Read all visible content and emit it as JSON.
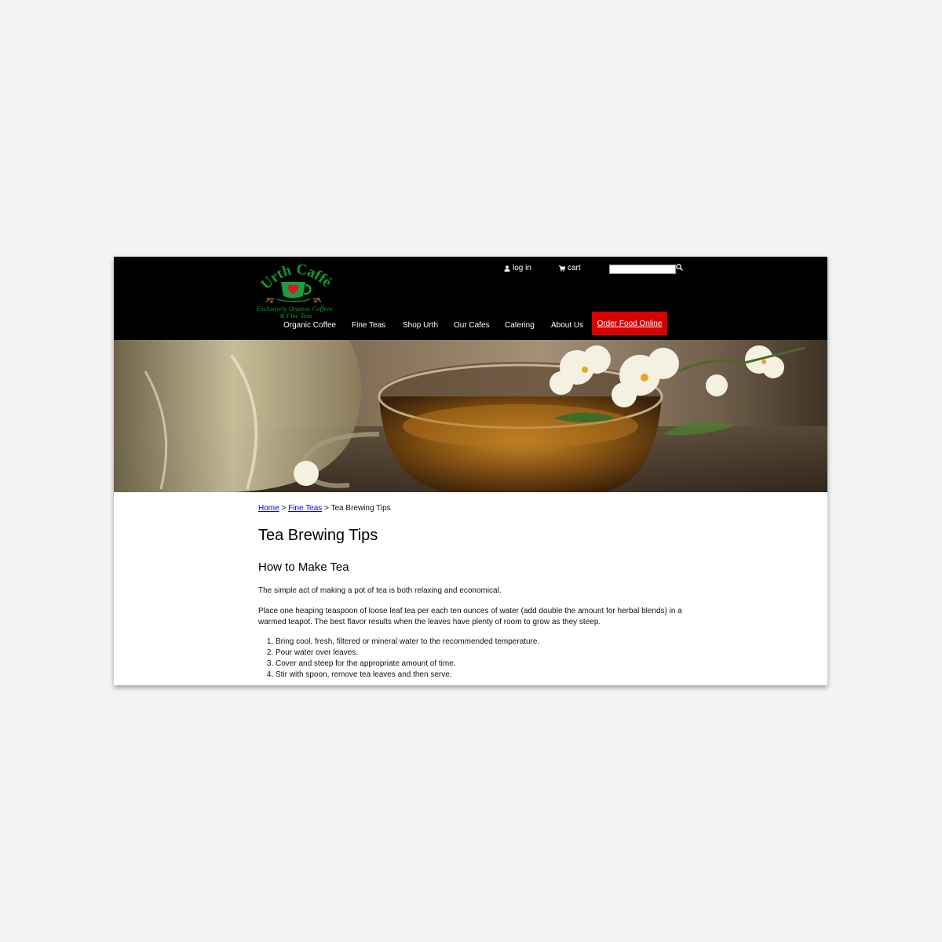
{
  "header": {
    "logo": {
      "brand": "Urth Caffé",
      "tagline_line1": "Exclusively Organic Coffees",
      "tagline_line2": "& Fine Teas",
      "colors": {
        "text": "#0f9a2b",
        "cup": "#1f9b45",
        "heart": "#d61a2a"
      }
    },
    "utility": {
      "login_label": "log in",
      "login_icon": "user-icon",
      "cart_label": "cart",
      "cart_icon": "cart-icon",
      "search_placeholder": "",
      "search_icon": "search-icon"
    },
    "nav": [
      "Organic Coffee",
      "Fine Teas",
      "Shop Urth",
      "Our Cafes",
      "Catering",
      "About Us"
    ],
    "order_button": {
      "label": "Order Food Online",
      "color": "#d90000"
    }
  },
  "breadcrumb": {
    "home": "Home",
    "sep1": " > ",
    "section": "Fine Teas",
    "sep2": " > ",
    "current": "Tea Brewing Tips"
  },
  "page": {
    "title": "Tea Brewing Tips",
    "subtitle": "How to Make Tea",
    "intro": "The simple act of making a pot of tea is both relaxing and economical.",
    "paragraph": "Place one heaping teaspoon of loose leaf tea per each ten ounces of water (add double the amount for herbal blends) in a warmed teapot. The best flavor results when the leaves have plenty of room to grow as they steep.",
    "steps": [
      "Bring cool, fresh, filtered or mineral water to the recommended temperature.",
      "Pour water over leaves.",
      "Cover and steep for the appropriate amount of time.",
      "Stir with spoon, remove tea leaves and then serve."
    ]
  }
}
